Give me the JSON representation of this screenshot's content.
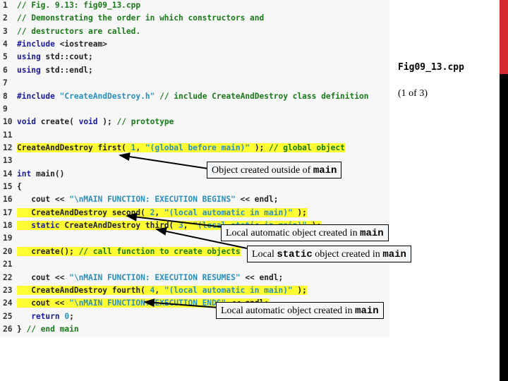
{
  "slide": {
    "title": "Fig09_13.cpp",
    "page_indicator": "(1 of 3)"
  },
  "code": {
    "lines": [
      {
        "n": "1",
        "hl": false,
        "parts": [
          [
            "cm",
            "// Fig. 9.13: fig09_13.cpp"
          ]
        ]
      },
      {
        "n": "2",
        "hl": false,
        "parts": [
          [
            "cm",
            "// Demonstrating the order in which constructors and"
          ]
        ]
      },
      {
        "n": "3",
        "hl": false,
        "parts": [
          [
            "cm",
            "// destructors are called."
          ]
        ]
      },
      {
        "n": "4",
        "hl": false,
        "parts": [
          [
            "pp",
            "#include "
          ],
          [
            "nr",
            "<iostream>"
          ]
        ]
      },
      {
        "n": "5",
        "hl": false,
        "parts": [
          [
            "kw",
            "using "
          ],
          [
            "nr",
            "std::cout;"
          ]
        ]
      },
      {
        "n": "6",
        "hl": false,
        "parts": [
          [
            "kw",
            "using "
          ],
          [
            "nr",
            "std::endl;"
          ]
        ]
      },
      {
        "n": "7",
        "hl": false,
        "parts": []
      },
      {
        "n": "8",
        "hl": false,
        "parts": [
          [
            "pp",
            "#include "
          ],
          [
            "st",
            "\"CreateAndDestroy.h\""
          ],
          [
            "nr",
            " "
          ],
          [
            "cm",
            "// include CreateAndDestroy class definition"
          ]
        ]
      },
      {
        "n": "9",
        "hl": false,
        "parts": []
      },
      {
        "n": "10",
        "hl": false,
        "parts": [
          [
            "kw",
            "void "
          ],
          [
            "nr",
            "create( "
          ],
          [
            "kw",
            "void"
          ],
          [
            "nr",
            " ); "
          ],
          [
            "cm",
            "// prototype"
          ]
        ]
      },
      {
        "n": "11",
        "hl": false,
        "parts": []
      },
      {
        "n": "12",
        "hl": true,
        "parts": [
          [
            "nr",
            "CreateAndDestroy first( "
          ],
          [
            "st",
            "1"
          ],
          [
            "nr",
            ", "
          ],
          [
            "st",
            "\"(global before main)\""
          ],
          [
            "nr",
            " ); "
          ],
          [
            "cm",
            "// global object"
          ]
        ]
      },
      {
        "n": "13",
        "hl": false,
        "parts": []
      },
      {
        "n": "14",
        "hl": false,
        "parts": [
          [
            "kw",
            "int "
          ],
          [
            "nr",
            "main()"
          ]
        ]
      },
      {
        "n": "15",
        "hl": false,
        "parts": [
          [
            "nr",
            "{"
          ]
        ]
      },
      {
        "n": "16",
        "hl": false,
        "parts": [
          [
            "nr",
            "   cout << "
          ],
          [
            "st",
            "\"\\nMAIN FUNCTION: EXECUTION BEGINS\""
          ],
          [
            "nr",
            " << endl;"
          ]
        ]
      },
      {
        "n": "17",
        "hl": true,
        "parts": [
          [
            "nr",
            "   CreateAndDestroy second( "
          ],
          [
            "st",
            "2"
          ],
          [
            "nr",
            ", "
          ],
          [
            "st",
            "\"(local automatic in main)\""
          ],
          [
            "nr",
            " );"
          ]
        ]
      },
      {
        "n": "18",
        "hl": true,
        "parts": [
          [
            "kw",
            "   static "
          ],
          [
            "nr",
            "CreateAndDestroy third( "
          ],
          [
            "st",
            "3"
          ],
          [
            "nr",
            ", "
          ],
          [
            "st",
            "\"(local static in main)\""
          ],
          [
            "nr",
            " );"
          ]
        ]
      },
      {
        "n": "19",
        "hl": false,
        "parts": []
      },
      {
        "n": "20",
        "hl": true,
        "parts": [
          [
            "nr",
            "   create(); "
          ],
          [
            "cm",
            "// call function to create objects"
          ]
        ]
      },
      {
        "n": "21",
        "hl": false,
        "parts": []
      },
      {
        "n": "22",
        "hl": false,
        "parts": [
          [
            "nr",
            "   cout << "
          ],
          [
            "st",
            "\"\\nMAIN FUNCTION: EXECUTION RESUMES\""
          ],
          [
            "nr",
            " << endl;"
          ]
        ]
      },
      {
        "n": "23",
        "hl": true,
        "parts": [
          [
            "nr",
            "   CreateAndDestroy fourth( "
          ],
          [
            "st",
            "4"
          ],
          [
            "nr",
            ", "
          ],
          [
            "st",
            "\"(local automatic in main)\""
          ],
          [
            "nr",
            " );"
          ]
        ]
      },
      {
        "n": "24",
        "hl": true,
        "parts": [
          [
            "nr",
            "   cout << "
          ],
          [
            "st",
            "\"\\nMAIN FUNCTION: EXECUTION ENDS\""
          ],
          [
            "nr",
            " << endl;"
          ]
        ]
      },
      {
        "n": "25",
        "hl": false,
        "parts": [
          [
            "kw",
            "   return "
          ],
          [
            "st",
            "0"
          ],
          [
            "nr",
            ";"
          ]
        ]
      },
      {
        "n": "26",
        "hl": false,
        "parts": [
          [
            "nr",
            "} "
          ],
          [
            "cm",
            "// end main"
          ]
        ]
      }
    ]
  },
  "callouts": {
    "global": {
      "pre": "Object created outside of ",
      "code": "main",
      "post": ""
    },
    "automatic1": {
      "pre": "Local automatic object created in ",
      "code": "main",
      "post": ""
    },
    "static": {
      "pre": "Local ",
      "code": "static",
      "mid": " object created in ",
      "code2": "main"
    },
    "automatic2": {
      "pre": "Local automatic object created in ",
      "code": "main",
      "post": ""
    }
  },
  "colors": {
    "highlight": "#ffff33",
    "comment": "#1a7a1a",
    "keyword": "#1a1aa0",
    "string": "#2a8fc0",
    "edge_red": "#d42a30",
    "edge_black": "#000000"
  }
}
